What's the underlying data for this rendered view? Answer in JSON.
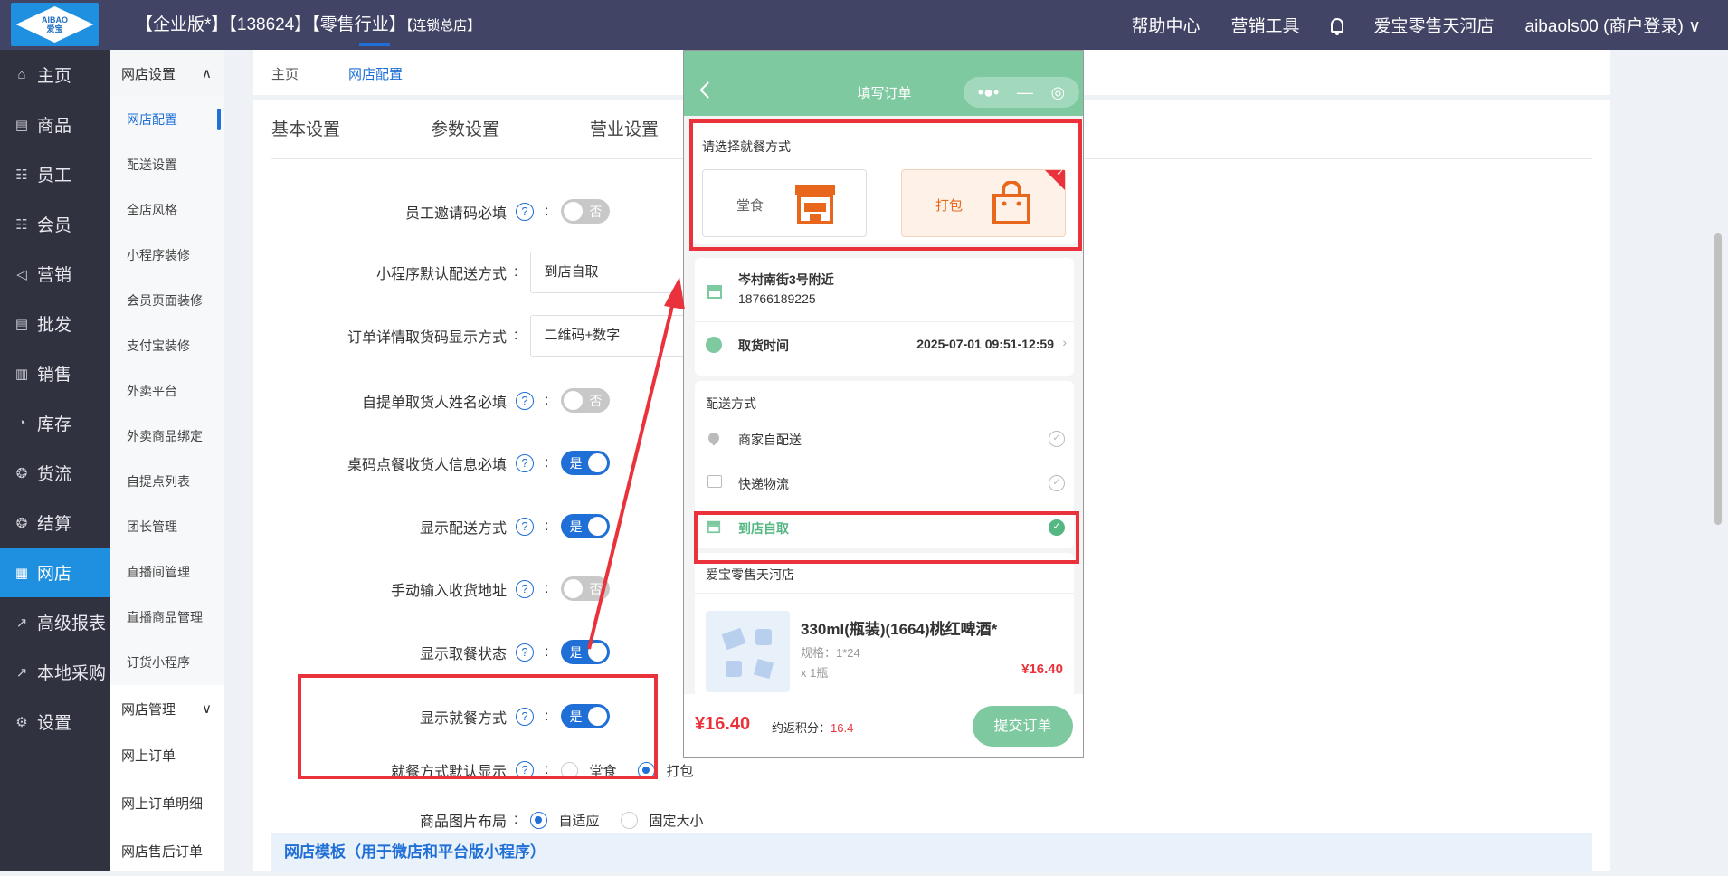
{
  "header": {
    "logo_text_top": "AIBAO",
    "logo_text_bottom": "爱宝",
    "title_main": "【企业版*】【138624】【零售行业】",
    "title_small": "【连锁总店】",
    "help": "帮助中心",
    "marketing_tools": "营销工具",
    "store": "爱宝零售天河店",
    "user": "aibaols00 (商户登录)",
    "user_caret": "∨"
  },
  "leftnav": [
    {
      "icon": "⌂",
      "label": "主页",
      "name": "home"
    },
    {
      "icon": "▤",
      "label": "商品",
      "name": "goods"
    },
    {
      "icon": "☷",
      "label": "员工",
      "name": "staff"
    },
    {
      "icon": "☷",
      "label": "会员",
      "name": "member"
    },
    {
      "icon": "◁",
      "label": "营销",
      "name": "marketing"
    },
    {
      "icon": "▤",
      "label": "批发",
      "name": "wholesale"
    },
    {
      "icon": "▥",
      "label": "销售",
      "name": "sales"
    },
    {
      "icon": "◔",
      "label": "库存",
      "name": "stock"
    },
    {
      "icon": "❂",
      "label": "货流",
      "name": "flow"
    },
    {
      "icon": "❂",
      "label": "结算",
      "name": "settle"
    },
    {
      "icon": "▦",
      "label": "网店",
      "name": "webshop"
    },
    {
      "icon": "↗",
      "label": "高级报表",
      "name": "reports"
    },
    {
      "icon": "↗",
      "label": "本地采购",
      "name": "purchase"
    },
    {
      "icon": "⚙",
      "label": "设置",
      "name": "settings"
    }
  ],
  "subnav": {
    "group1": "网店设置",
    "group1_caret": "∧",
    "items": [
      "网店配置",
      "配送设置",
      "全店风格",
      "小程序装修",
      "会员页面装修",
      "支付宝装修",
      "外卖平台",
      "外卖商品绑定",
      "自提点列表",
      "团长管理",
      "直播间管理",
      "直播商品管理",
      "订货小程序"
    ],
    "group2": "网店管理",
    "group2_caret": "∨",
    "group2_items": [
      "网上订单",
      "网上订单明细",
      "网店售后订单"
    ]
  },
  "crumbs": [
    "主页",
    "网店配置"
  ],
  "tabs": [
    "基本设置",
    "参数设置",
    "营业设置"
  ],
  "form": {
    "q": "?",
    "colon": ":",
    "rows": [
      {
        "label": "员工邀请码必填",
        "switch": "否"
      },
      {
        "label": "小程序默认配送方式",
        "select": "到店自取"
      },
      {
        "label": "订单详情取货码显示方式",
        "select": "二维码+数字"
      },
      {
        "label": "自提单取货人姓名必填",
        "switch": "否"
      },
      {
        "label": "桌码点餐收货人信息必填",
        "switch": "是"
      },
      {
        "label": "显示配送方式",
        "switch": "是"
      },
      {
        "label": "手动输入收货地址",
        "switch": "否"
      },
      {
        "label": "显示取餐状态",
        "switch": "是"
      },
      {
        "label": "显示就餐方式",
        "switch": "是"
      },
      {
        "label": "就餐方式默认显示",
        "radios": [
          "堂食",
          "打包"
        ],
        "selected": 1
      },
      {
        "label": "商品图片布局",
        "radios": [
          "自适应",
          "固定大小"
        ],
        "selected": 0
      }
    ]
  },
  "template_bar": "网店模板（用于微店和平台版小程序）",
  "phone": {
    "title": "填写订单",
    "capsule_more": "•●•",
    "capsule_min": "—",
    "capsule_close": "◎",
    "mode_title": "请选择就餐方式",
    "mode_dine": "堂食",
    "mode_pack": "打包",
    "addr": "岑村南街3号附近",
    "phone": "18766189225",
    "pickup_label": "取货时间",
    "pickup_time": "2025-07-01 09:51-12:59",
    "pickup_caret": "›",
    "delivery_title": "配送方式",
    "delivery_opts": [
      "商家自配送",
      "快递物流",
      "到店自取"
    ],
    "check": "✓",
    "shop": "爱宝零售天河店",
    "product": "330ml(瓶装)(1664)桃红啤酒*",
    "spec": "规格：1*24",
    "qty": "x 1瓶",
    "price": "¥16.40",
    "total": "¥16.40",
    "points_label": "约返积分：",
    "points": "16.4",
    "submit": "提交订单"
  },
  "colors": {
    "accent": "#1f6fd6",
    "nav_active": "#1f8fe0",
    "mini_green": "#7fc9a1",
    "annotation_red": "#e9323b",
    "orange": "#e8671c"
  }
}
